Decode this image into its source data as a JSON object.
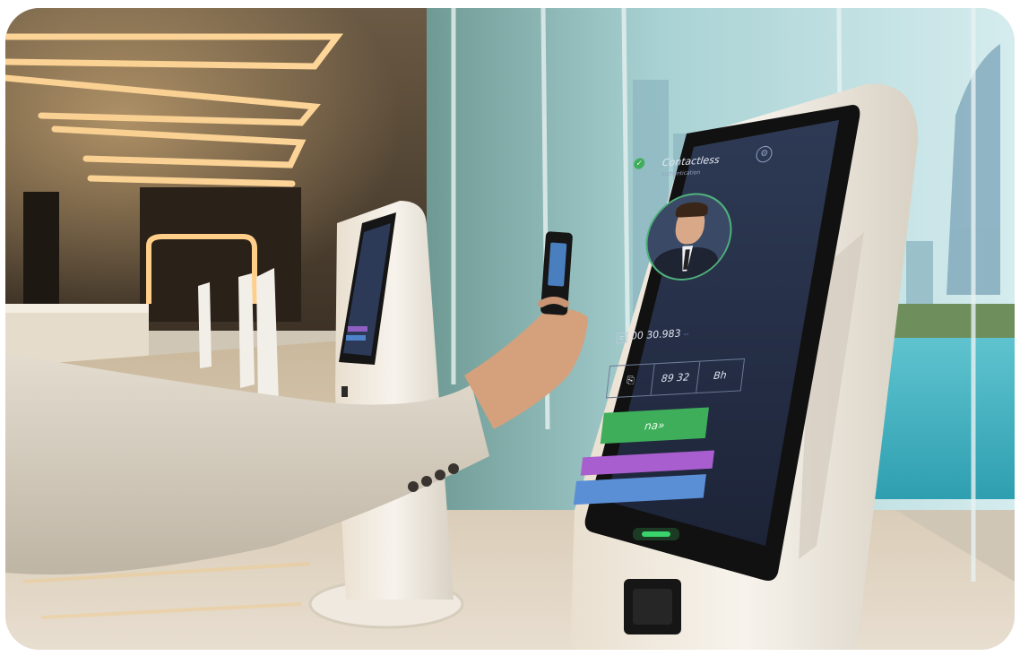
{
  "scene": {
    "description_colors": {
      "lobby_floor": "#d8cbb6",
      "glass": "#9fcfcf",
      "kiosk_body": "#f1ede6",
      "kiosk_bezel": "#151515",
      "screen_bg": "#25304a",
      "sleeve": "#d9d2c4"
    }
  },
  "kiosk": {
    "screen": {
      "title": "Contactless",
      "subtitle": "Authentication",
      "id_number": "00 30.983 ",
      "id_suffix": "-- ",
      "cells": [
        "⎘",
        "89 32",
        "Bh"
      ],
      "confirm_label": "na»",
      "status_icon": "check-icon",
      "settings_icon": "gear-icon"
    },
    "led_color": "#39d46b"
  },
  "colors": {
    "confirm_button": "#3fae5a",
    "purple_bar": "#a95ecf",
    "blue_bar": "#5a8fd6"
  }
}
